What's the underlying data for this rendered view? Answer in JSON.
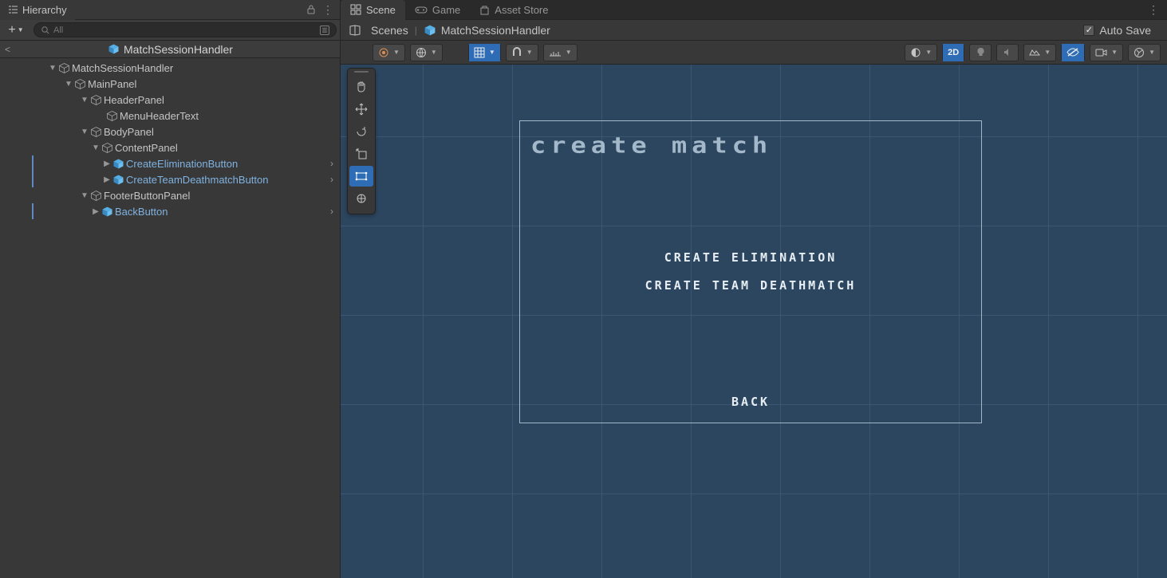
{
  "hierarchy": {
    "tab_label": "Hierarchy",
    "search_placeholder": "All",
    "breadcrumb": "MatchSessionHandler",
    "tree": {
      "root": "MatchSessionHandler",
      "mainPanel": "MainPanel",
      "headerPanel": "HeaderPanel",
      "menuHeaderText": "MenuHeaderText",
      "bodyPanel": "BodyPanel",
      "contentPanel": "ContentPanel",
      "createElim": "CreateEliminationButton",
      "createTdm": "CreateTeamDeathmatchButton",
      "footerPanel": "FooterButtonPanel",
      "backBtn": "BackButton"
    }
  },
  "scene": {
    "tabs": {
      "scene": "Scene",
      "game": "Game",
      "assetStore": "Asset Store"
    },
    "crumb": {
      "scenes": "Scenes",
      "prefab": "MatchSessionHandler"
    },
    "autoSave": "Auto Save",
    "toolbar": {
      "mode2d": "2D"
    }
  },
  "game_ui": {
    "title": "Create Match",
    "create_elimination": "CREATE ELIMINATION",
    "create_team_deathmatch": "CREATE TEAM DEATHMATCH",
    "back": "BACK"
  }
}
